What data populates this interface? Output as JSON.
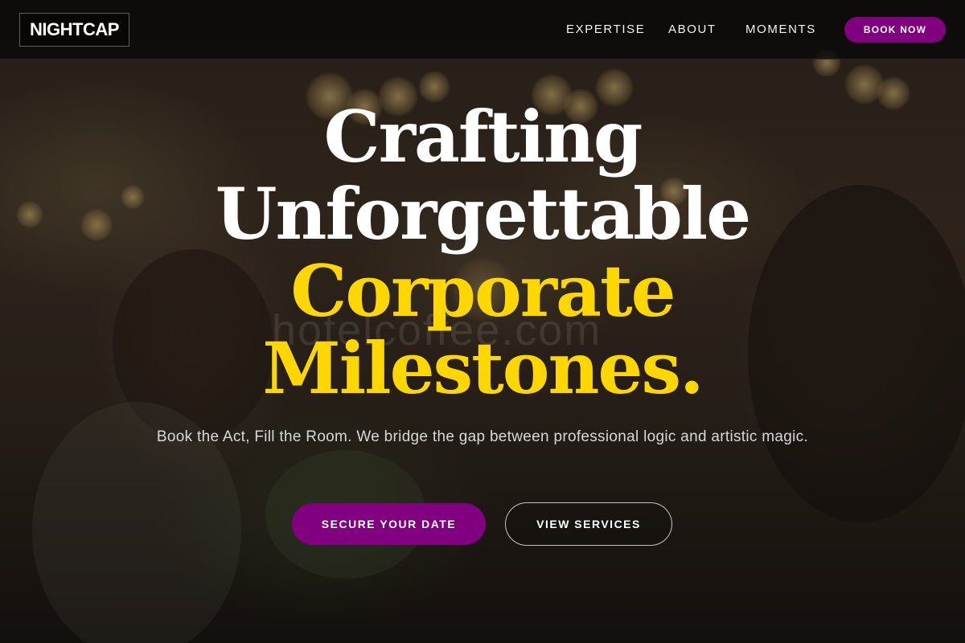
{
  "header": {
    "logo": "NIGHTCAP",
    "nav": [
      {
        "label": "EXPERTISE"
      },
      {
        "label": "ABOUT"
      },
      {
        "label": "MOMENTS"
      }
    ],
    "cta_label": "BOOK NOW"
  },
  "hero": {
    "headline_lines": [
      "Crafting",
      "Unforgettable",
      "Corporate",
      "Milestones."
    ],
    "subtitle": "Book the Act, Fill the Room. We bridge the gap between professional logic and artistic magic.",
    "primary_button": "SECURE YOUR DATE",
    "secondary_button": "VIEW SERVICES",
    "watermark": "hotelcoffee.com"
  },
  "colors": {
    "accent_purple": "#800080",
    "headline_gold": "#ffd700",
    "headline_white": "#ffffff"
  }
}
